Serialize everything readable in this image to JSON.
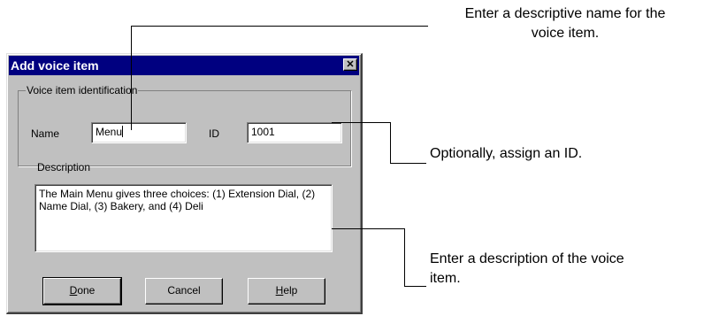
{
  "dialog": {
    "title": "Add voice item",
    "close_glyph": "✕",
    "group_label": "Voice item identification",
    "name_label": "Name",
    "name_value": "Menu",
    "id_label": "ID",
    "id_value": "1001",
    "description_label": "Description",
    "description_value": "The Main Menu gives three choices: (1) Extension Dial, (2) Name Dial, (3) Bakery, and (4) Deli",
    "buttons": {
      "done_first": "D",
      "done_rest": "one",
      "cancel": "Cancel",
      "help_first": "H",
      "help_rest": "elp"
    }
  },
  "callouts": {
    "name_line1": "Enter a descriptive name for the",
    "name_line2": "voice item.",
    "id": "Optionally, assign an ID.",
    "description_line1": "Enter a description of the voice",
    "description_line2": "item."
  },
  "colors": {
    "face": "#c0c0c0",
    "titlebar": "#000080",
    "field": "#ffffff"
  },
  "icons": {
    "close": "close-icon"
  }
}
